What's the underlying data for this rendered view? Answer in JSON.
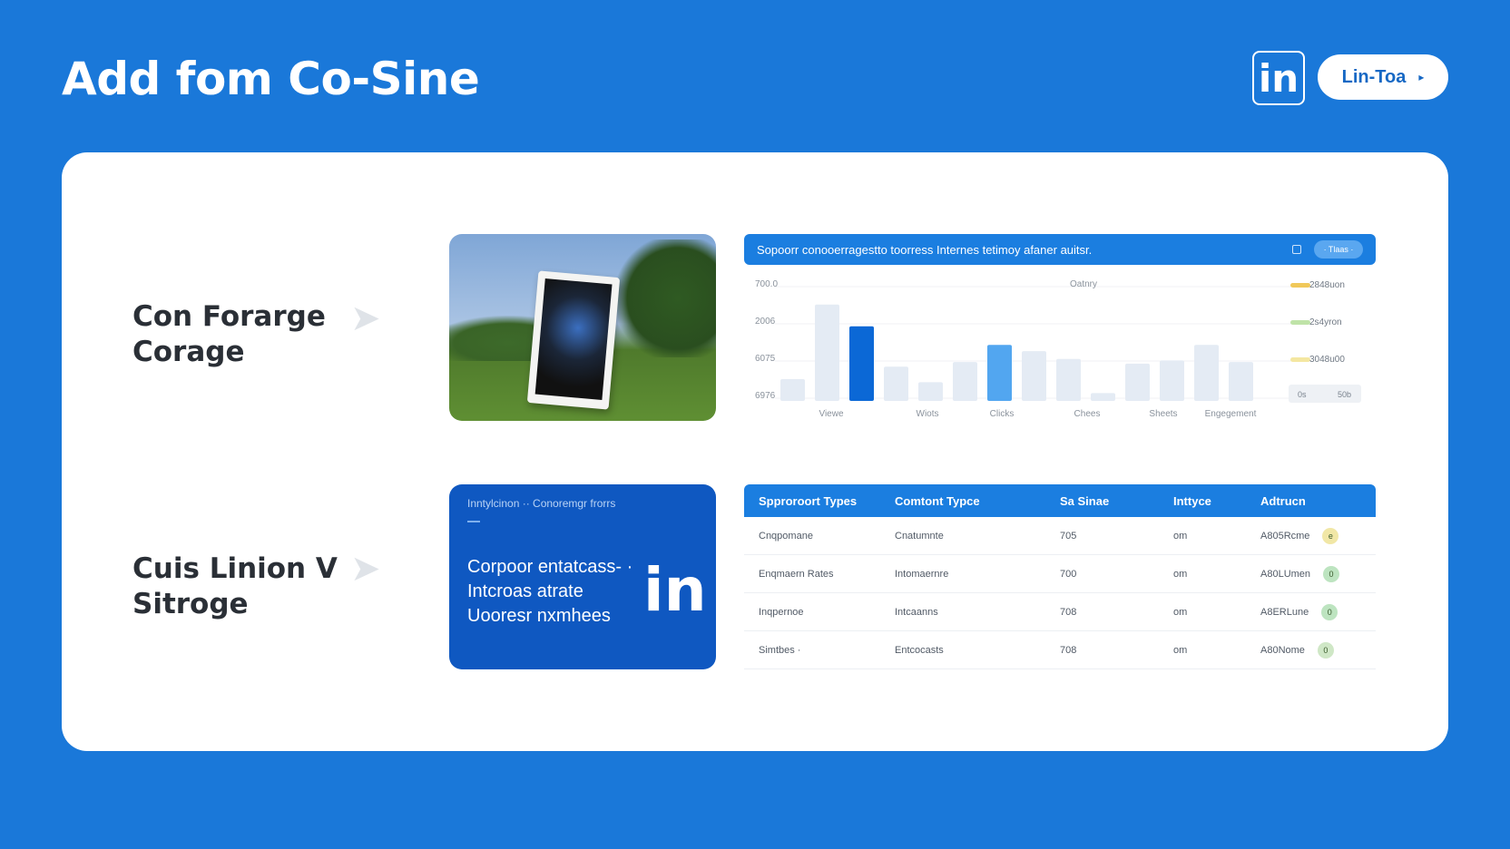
{
  "header": {
    "title": "Add fom Co-Sine",
    "logo_text": "in",
    "pill_label": "Lin-Toa",
    "pill_chevron": "▸"
  },
  "rows": [
    {
      "label_line1": "Con Forarge",
      "label_line2": "Corage",
      "arrow": "➤"
    },
    {
      "label_line1": "Cuis Linion V",
      "label_line2": "Sitroge",
      "arrow": "➤"
    }
  ],
  "chart_panel": {
    "header_title": "Sopoorr conooerragestto toorress Internes tetimoy afaner auitsr.",
    "header_button": "· Tlaas ·",
    "legend_title": "Oatnry"
  },
  "chart_data": {
    "type": "bar",
    "title": "Sopoorr conooerragestto toorress Internes tetimoy afaner auitsr.",
    "y_tick_labels": [
      "700.0",
      "2006",
      "6075",
      "6976"
    ],
    "x_labels": [
      "Viewe",
      "Wiots",
      "Clicks",
      "Chees",
      "Sheets",
      "Engegement"
    ],
    "values": [
      14,
      62,
      48,
      22,
      12,
      25,
      36,
      32,
      27,
      5,
      24,
      26,
      36,
      25
    ],
    "highlight": [
      2,
      6
    ],
    "ylim": [
      0,
      70
    ],
    "legend": [
      "2848uon",
      "2s4yron",
      "3048u00"
    ],
    "legend_colors": [
      "#f0c85a",
      "#bfe3a8",
      "#f4e7a1"
    ],
    "footer": [
      "0s",
      "50b"
    ],
    "bar_color": "#e4ebf4",
    "highlight_colors": [
      "#0b68d6",
      "#52a6f0"
    ]
  },
  "promo": {
    "small_text": "Inntylcinon ·· Conoremgr frorrs",
    "line1": "Corpoor entatcass- ·",
    "line2": "Intcroas atrate",
    "line3": "Uooresr nxmhees",
    "logo": "in"
  },
  "table": {
    "headers": [
      "Spproroort Types",
      "Comtont Typce",
      "Sa Sinae",
      "Inttyce",
      "Adtrucn"
    ],
    "rows": [
      [
        "Cnqpomane",
        "Cnatumnte",
        "705",
        "om",
        "A805Rcme",
        "e",
        "#f1e7a6"
      ],
      [
        "Enqmaern Rates",
        "Intomaernre",
        "700",
        "om",
        "A80LUmen",
        "0",
        "#bde4c0"
      ],
      [
        "Inqpernoe",
        "Intcaanns",
        "708",
        "om",
        "A8ERLune",
        "0",
        "#bde4c0"
      ],
      [
        "Simtbes ·",
        "Entcocasts",
        "708",
        "om",
        "A80Nome",
        "0",
        "#cfe7c6"
      ]
    ]
  },
  "colors": {
    "background": "#1a78d9",
    "accent": "#1b7ee0",
    "promo": "#0f58c1"
  }
}
